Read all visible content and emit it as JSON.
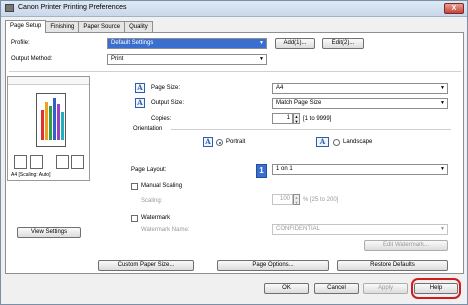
{
  "window": {
    "title": "Canon Printer Printing Preferences",
    "close_label": "X"
  },
  "tabs": [
    "Page Setup",
    "Finishing",
    "Paper Source",
    "Quality"
  ],
  "profile": {
    "label": "Profile:",
    "value": "Default Settings",
    "add_label": "Add(1)...",
    "edit_label": "Edit(2)..."
  },
  "output_method": {
    "label": "Output Method:",
    "value": "Print"
  },
  "preview": {
    "caption": "A4 [Scaling: Auto]",
    "view_settings_label": "View Settings"
  },
  "page_size": {
    "label": "Page Size:",
    "value": "A4"
  },
  "output_size": {
    "label": "Output Size:",
    "value": "Match Page Size"
  },
  "copies": {
    "label": "Copies:",
    "value": "1",
    "range": "[1 to 9999]"
  },
  "orientation": {
    "label": "Orientation",
    "portrait": "Portrait",
    "landscape": "Landscape"
  },
  "page_layout": {
    "label": "Page Layout:",
    "value": "1 on 1"
  },
  "manual_scaling": {
    "label": "Manual Scaling",
    "scaling_label": "Scaling:",
    "value": "100",
    "range": "% [25 to 200]"
  },
  "watermark": {
    "label": "Watermark",
    "name_label": "Watermark Name:",
    "value": "CONFIDENTIAL",
    "edit_label": "Edit Watermark..."
  },
  "bottom_row": {
    "custom_paper": "Custom Paper Size...",
    "page_options": "Page Options...",
    "restore_defaults": "Restore Defaults"
  },
  "dialog_buttons": {
    "ok": "OK",
    "cancel": "Cancel",
    "apply": "Apply",
    "help": "Help"
  },
  "colors": {
    "highlight": "#3a6fd0",
    "help_circle": "#d21c1c"
  }
}
